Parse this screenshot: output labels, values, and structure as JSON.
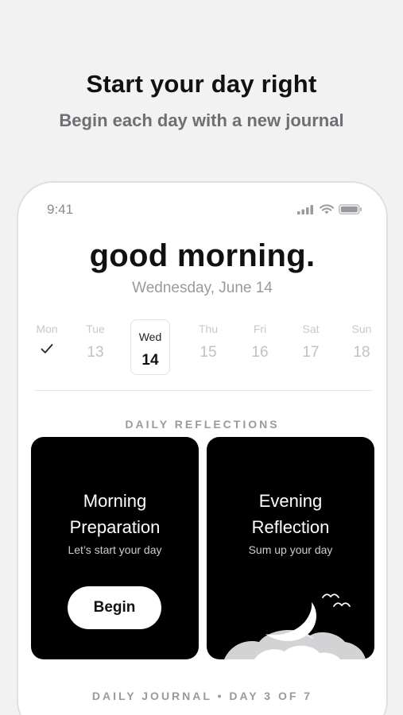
{
  "hero": {
    "title": "Start your day right",
    "subtitle": "Begin each day with a new journal"
  },
  "status_bar": {
    "time": "9:41",
    "icons": [
      "cellular-signal-icon",
      "wifi-icon",
      "battery-icon"
    ]
  },
  "greeting": "good morning.",
  "date": "Wednesday, June 14",
  "week": [
    {
      "name": "Mon",
      "num": "",
      "completed": true
    },
    {
      "name": "Tue",
      "num": "13"
    },
    {
      "name": "Wed",
      "num": "14",
      "selected": true
    },
    {
      "name": "Thu",
      "num": "15"
    },
    {
      "name": "Fri",
      "num": "16"
    },
    {
      "name": "Sat",
      "num": "17"
    },
    {
      "name": "Sun",
      "num": "18"
    }
  ],
  "daily_reflections": {
    "label": "DAILY REFLECTIONS",
    "cards": [
      {
        "title_line1": "Morning",
        "title_line2": "Preparation",
        "subtitle": "Let’s start your day",
        "button": "Begin"
      },
      {
        "title_line1": "Evening",
        "title_line2": "Reflection",
        "subtitle": "Sum up your day"
      }
    ]
  },
  "daily_journal": {
    "label": "DAILY JOURNAL • DAY 3 OF 7"
  },
  "colors": {
    "background": "#f2f2f3",
    "card": "#000000",
    "text": "#111111",
    "muted": "#9a9a9e"
  }
}
